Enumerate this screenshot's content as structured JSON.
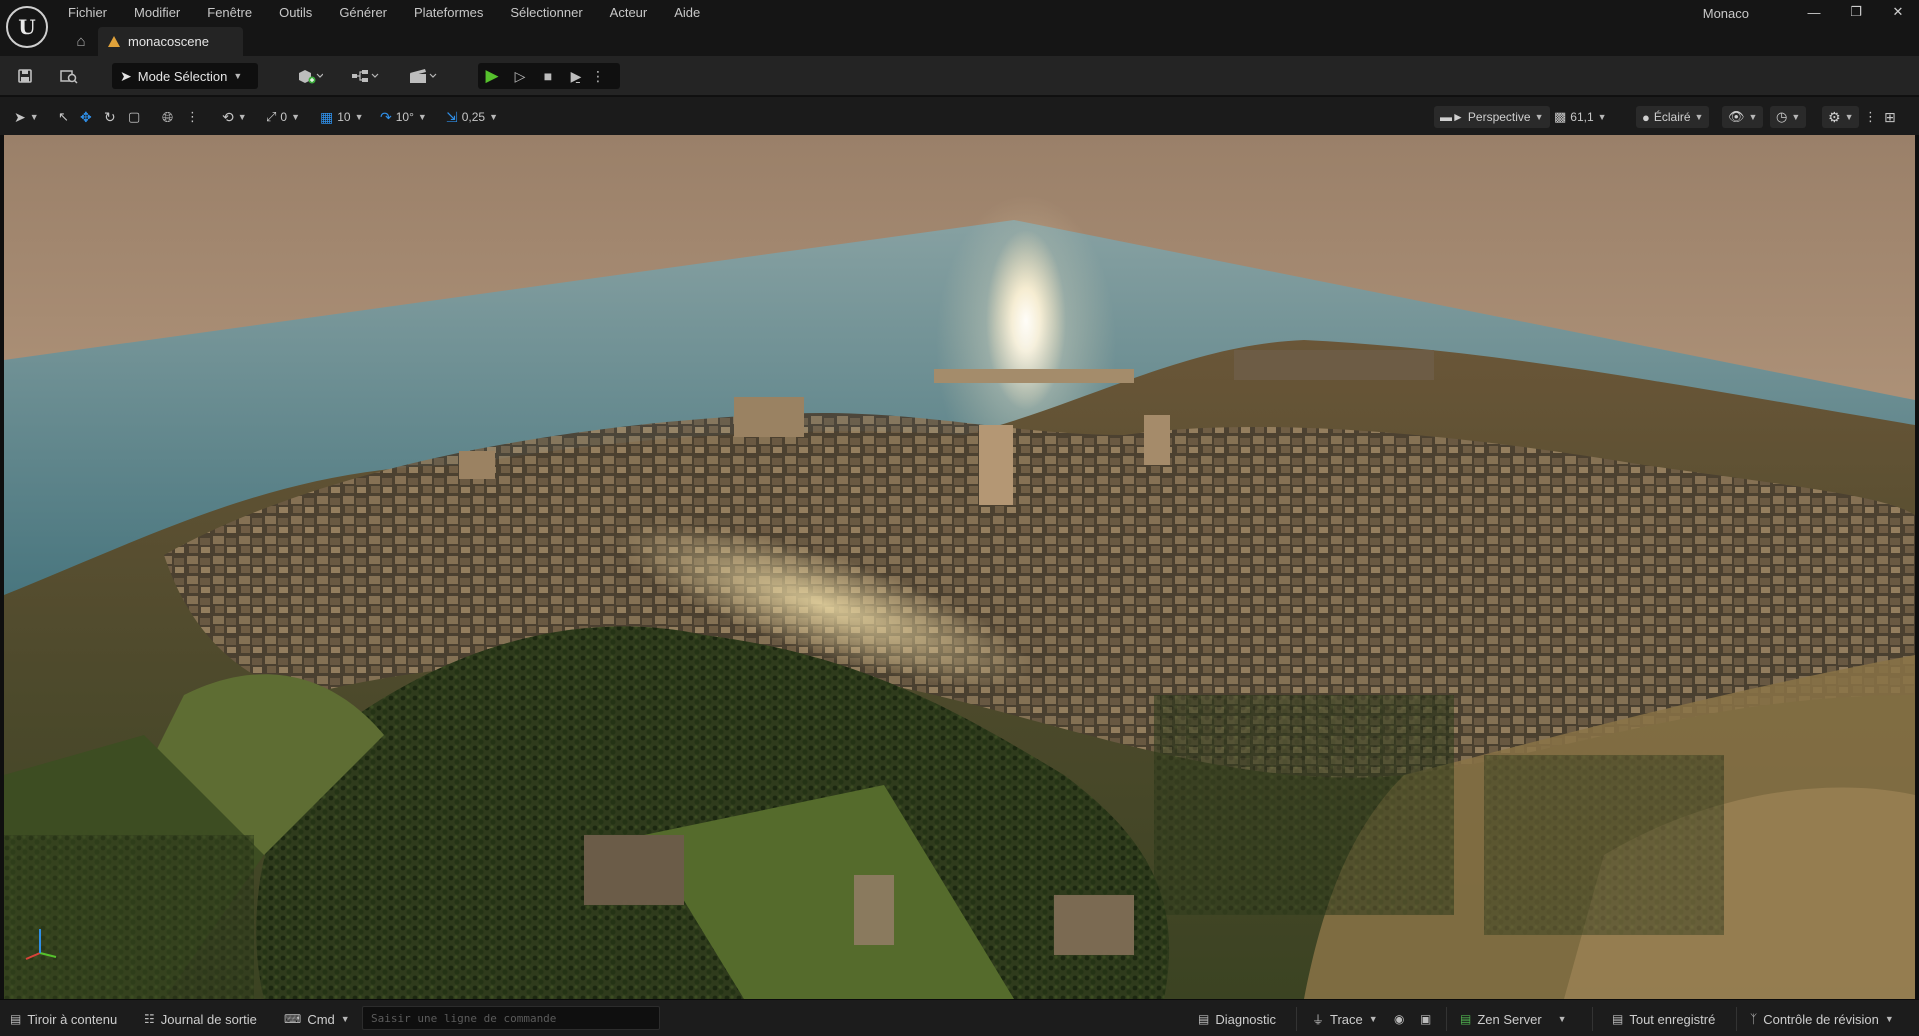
{
  "app": {
    "logo": "ue-logo",
    "menu": [
      "Fichier",
      "Modifier",
      "Fenêtre",
      "Outils",
      "Générer",
      "Plateformes",
      "Sélectionner",
      "Acteur",
      "Aide"
    ],
    "project_name": "Monaco",
    "window_controls": [
      "minimize-icon",
      "restore-icon",
      "close-icon"
    ]
  },
  "tabs": [
    {
      "label": "monacoscene",
      "icon": "level-icon",
      "active": true
    }
  ],
  "toolbar": {
    "mode_label": "Mode Sélection",
    "icons": [
      "save-icon",
      "content-browser-icon",
      "add-actor-icon",
      "blueprint-icon",
      "cinematics-icon"
    ],
    "play_controls": [
      "play-icon",
      "advance-frame-icon",
      "stop-icon",
      "simulate-icon",
      "more-options-icon"
    ]
  },
  "viewport_toolbar": {
    "rotation_snap_small": "0",
    "grid_snap": "10",
    "rotation_snap": "10°",
    "scale_snap": "0,25",
    "view_mode": "Perspective",
    "camera_speed": "61,1",
    "lighting_mode": "Éclairé"
  },
  "statusbar": {
    "content_drawer": "Tiroir à contenu",
    "output_log": "Journal de sortie",
    "cmd_label": "Cmd",
    "cmd_placeholder": "Saisir une ligne de commande",
    "diagnostic": "Diagnostic",
    "trace": "Trace",
    "zen_server": "Zen Server",
    "save_status": "Tout enregistré",
    "revision_control": "Contrôle de révision"
  },
  "colors": {
    "accent_blue": "#2f8fe8",
    "play_green": "#56c12d",
    "tab_level_orange": "#e0a23a",
    "zen_green": "#4fb04f"
  },
  "viewport": {
    "scene": "aerial-city-render",
    "gizmo_axes": [
      "X",
      "Y",
      "Z"
    ]
  }
}
